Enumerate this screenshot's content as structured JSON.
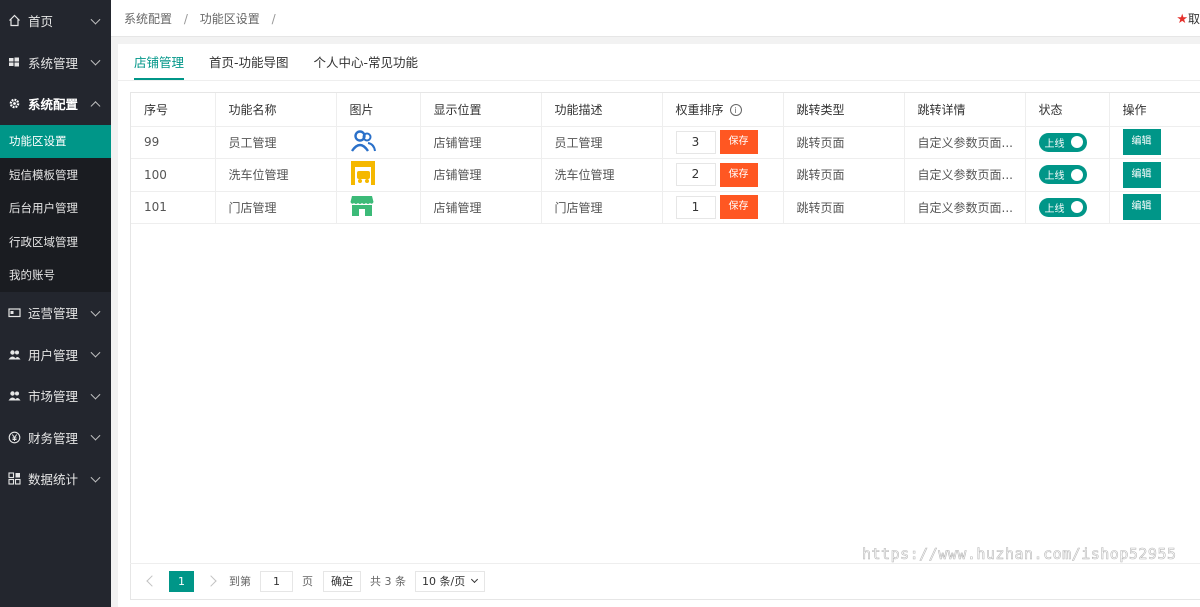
{
  "sidebar": {
    "items": [
      {
        "label": "首页",
        "icon": "home-icon"
      },
      {
        "label": "系统管理",
        "icon": "windows-icon"
      },
      {
        "label": "系统配置",
        "icon": "gear-icon"
      }
    ],
    "sub_items": [
      "功能区设置",
      "短信模板管理",
      "后台用户管理",
      "行政区域管理",
      "我的账号"
    ],
    "bottom_items": [
      {
        "label": "运营管理",
        "icon": "card-icon"
      },
      {
        "label": "用户管理",
        "icon": "users-icon"
      },
      {
        "label": "市场管理",
        "icon": "users-icon"
      },
      {
        "label": "财务管理",
        "icon": "yen-icon"
      },
      {
        "label": "数据统计",
        "icon": "grid-icon"
      }
    ]
  },
  "header": {
    "crumbs": [
      "系统配置",
      "功能区设置"
    ],
    "right_text": "取"
  },
  "tabs": [
    "店铺管理",
    "首页-功能导图",
    "个人中心-常见功能"
  ],
  "table": {
    "headers": [
      "序号",
      "功能名称",
      "图片",
      "显示位置",
      "功能描述",
      "权重排序",
      "跳转类型",
      "跳转详情",
      "状态",
      "操作"
    ],
    "save_label": "保存",
    "status_label": "上线",
    "edit_label": "编辑",
    "rows": [
      {
        "seq": "99",
        "name": "员工管理",
        "image": "staff-icon",
        "position": "店铺管理",
        "desc": "员工管理",
        "weight": "3",
        "jump_type": "跳转页面",
        "jump_detail": "自定义参数页面..."
      },
      {
        "seq": "100",
        "name": "洗车位管理",
        "image": "car-wash-icon",
        "position": "店铺管理",
        "desc": "洗车位管理",
        "weight": "2",
        "jump_type": "跳转页面",
        "jump_detail": "自定义参数页面..."
      },
      {
        "seq": "101",
        "name": "门店管理",
        "image": "store-icon",
        "position": "店铺管理",
        "desc": "门店管理",
        "weight": "1",
        "jump_type": "跳转页面",
        "jump_detail": "自定义参数页面..."
      }
    ]
  },
  "pager": {
    "current": "1",
    "goto_label": "到第",
    "goto_value": "1",
    "page_label": "页",
    "confirm_label": "确定",
    "total_label": "共 3 条",
    "size_label": "10 条/页"
  },
  "watermark": "https://www.huzhan.com/ishop52955",
  "colors": {
    "accent": "#009688",
    "danger": "#ff5722",
    "sidebar": "#23262e"
  }
}
